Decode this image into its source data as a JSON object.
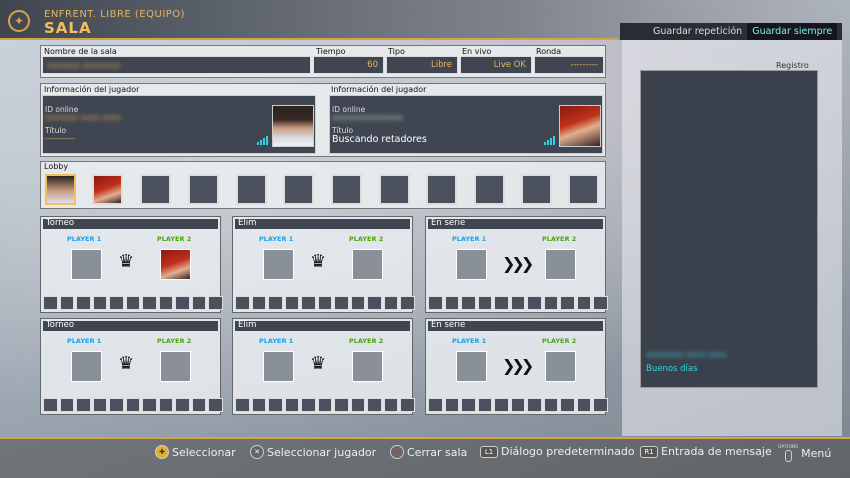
{
  "header": {
    "mode": "ENFRENT. LIBRE (EQUIPO)",
    "title": "SALA",
    "tabs": [
      "Guardar repetición",
      "Guardar siempre"
    ]
  },
  "room": {
    "name_label": "Nombre de la sala",
    "name_value": "xxxxxxx xxxxxxxx",
    "time_label": "Tiempo",
    "time_value": "60",
    "type_label": "Tipo",
    "type_value": "Libre",
    "live_label": "En vivo",
    "live_value": "Live OK",
    "round_label": "Ronda",
    "round_value": "---------"
  },
  "player_left": {
    "header": "Información del jugador",
    "id_label": "ID online",
    "id_value": "xxxxxxx xxxx xxxx",
    "title_label": "Título",
    "title_value": "-----------"
  },
  "player_right": {
    "header": "Información del jugador",
    "id_label": "ID online",
    "id_value": "xxxxxxxxxxxxxxx",
    "title_label": "Título",
    "title_value": "Buscando retadores"
  },
  "lobby": {
    "label": "Lobby"
  },
  "matches": [
    {
      "title": "Torneo",
      "p1": "PLAYER 1",
      "p2": "PLAYER 2",
      "kind": "crown"
    },
    {
      "title": "Elim",
      "p1": "PLAYER 1",
      "p2": "PLAYER 2",
      "kind": "crown"
    },
    {
      "title": "En serie",
      "p1": "PLAYER 1",
      "p2": "PLAYER 2",
      "kind": "chevron"
    },
    {
      "title": "Torneo",
      "p1": "PLAYER 1",
      "p2": "PLAYER 2",
      "kind": "crown"
    },
    {
      "title": "Elim",
      "p1": "PLAYER 1",
      "p2": "PLAYER 2",
      "kind": "crown"
    },
    {
      "title": "En serie",
      "p1": "PLAYER 1",
      "p2": "PLAYER 2",
      "kind": "chevron"
    }
  ],
  "log": {
    "label": "Registro",
    "sender": "xxxxxxxx xxxx xxxx",
    "message": "Buenos días"
  },
  "footer": {
    "select": "Seleccionar",
    "select_player": "Seleccionar jugador",
    "close_room": "Cerrar sala",
    "default_dialog": "Diálogo predeterminado",
    "message_input": "Entrada de mensaje",
    "menu": "Menú",
    "l1": "L1",
    "r1": "R1",
    "options": "OPTIONS"
  }
}
